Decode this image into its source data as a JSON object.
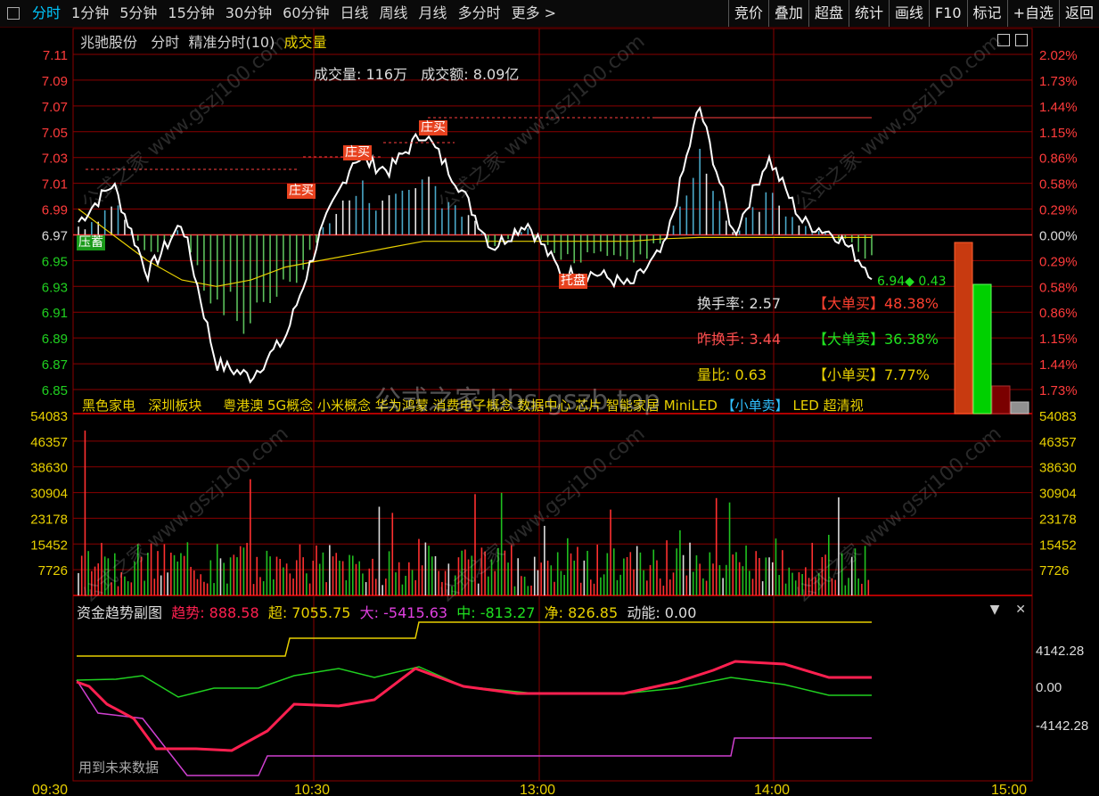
{
  "toolbar": {
    "periods": [
      "分时",
      "1分钟",
      "5分钟",
      "15分钟",
      "30分钟",
      "60分钟",
      "日线",
      "周线",
      "月线",
      "多分时",
      "更多 >"
    ],
    "right_buttons": [
      "竞价",
      "叠加",
      "超盘",
      "统计",
      "画线",
      "F10",
      "标记",
      "+自选",
      "返回"
    ]
  },
  "header": {
    "stock": "兆驰股份",
    "mode": "分时",
    "precise": "精准分时(10)",
    "volume_toggle": "成交量"
  },
  "summary": {
    "volume": "成交量: 116万",
    "amount": "成交额: 8.09亿"
  },
  "tags": {
    "ya_zhen": "压蓄",
    "zhuang_mai": "庄买",
    "zhuang_mai2": "庄买",
    "zhuang_mai3": "庄买",
    "tuo_pan": "托盘"
  },
  "stats": {
    "turnover_label": "换手率: 2.57",
    "prev_turnover_label": "昨换手: 3.44",
    "vol_ratio_label": "量比: 0.63",
    "big_buy": "【大单买】48.38%",
    "big_sell": "【大单卖】36.38%",
    "small_buy": "【小单买】7.77%",
    "small_sell": "【小单卖】",
    "price_now": "6.94◆ 0.43"
  },
  "concepts": [
    "黑色家电",
    "深圳板块",
    "粤港澳",
    "5G概念",
    "小米概念",
    "华为鸿蒙",
    "消费电子概念",
    "数据中心",
    "芯片",
    "智能家居",
    "MiniLED",
    "LED",
    "超清视"
  ],
  "watermark": {
    "small": "公式之家 www.gszj100.com",
    "big": "公式之家 bbs.gszb.top"
  },
  "price_axis": {
    "left": [
      "7.11",
      "7.09",
      "7.07",
      "7.05",
      "7.03",
      "7.01",
      "6.99",
      "6.97",
      "6.95",
      "6.93",
      "6.91",
      "6.89",
      "6.87",
      "6.85"
    ],
    "right": [
      "2.02%",
      "1.73%",
      "1.44%",
      "1.15%",
      "0.86%",
      "0.58%",
      "0.29%",
      "0.00%",
      "0.29%",
      "0.58%",
      "0.86%",
      "1.15%",
      "1.44%",
      "1.73%"
    ]
  },
  "volume_axis": [
    "54083",
    "46357",
    "38630",
    "30904",
    "23178",
    "15452",
    "7726"
  ],
  "sub_chart": {
    "name": "资金趋势副图",
    "trend": "趋势: 888.58",
    "super": "超: 7055.75",
    "big": "大: -5415.63",
    "mid": "中: -813.27",
    "net": "净: 826.85",
    "momentum": "动能: 0.00",
    "axis": [
      "4142.28",
      "0.00",
      "-4142.28"
    ],
    "note": "用到未来数据"
  },
  "time_axis": [
    "09:30",
    "10:30",
    "13:00",
    "14:00",
    "15:00"
  ],
  "colors": {
    "up": "#ff3030",
    "down": "#20c020",
    "grid": "#8a0000",
    "avg": "#e8d000",
    "price": "#ffffff"
  },
  "chart_data": {
    "type": "line",
    "price_range": [
      6.85,
      7.11
    ],
    "base_price": 6.97,
    "price_series_approx": [
      6.98,
      7.01,
      6.94,
      6.98,
      6.87,
      6.86,
      6.89,
      6.97,
      7.03,
      7.02,
      7.05,
      7.01,
      6.96,
      6.98,
      6.94,
      6.94,
      6.93,
      6.96,
      7.07,
      6.97,
      7.03,
      6.98,
      6.97,
      6.94
    ],
    "avg_series_approx": [
      6.99,
      6.97,
      6.95,
      6.935,
      6.93,
      6.935,
      6.945,
      6.95,
      6.955,
      6.96,
      6.965,
      6.965,
      6.965,
      6.965,
      6.965,
      6.965,
      6.965,
      6.967,
      6.968,
      6.968,
      6.968,
      6.968,
      6.968,
      6.968
    ]
  }
}
